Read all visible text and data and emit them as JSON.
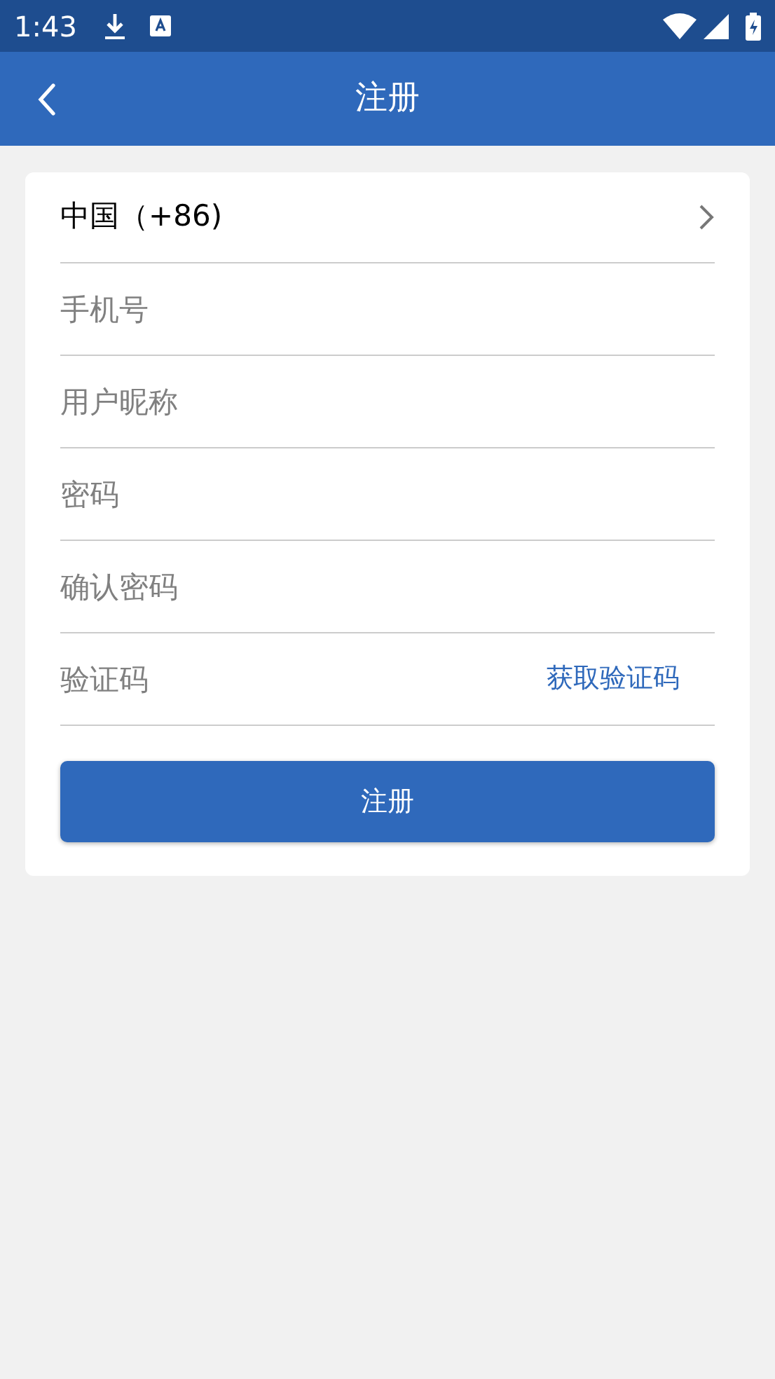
{
  "status_bar": {
    "time": "1:43"
  },
  "app_bar": {
    "title": "注册"
  },
  "country": {
    "value": "中国（+86)"
  },
  "fields": [
    {
      "kind": "text",
      "placeholder": "手机号"
    },
    {
      "kind": "text",
      "placeholder": "用户昵称"
    },
    {
      "kind": "password",
      "placeholder": "密码"
    },
    {
      "kind": "password",
      "placeholder": "确认密码"
    },
    {
      "kind": "code",
      "placeholder": "验证码",
      "action": "获取验证码"
    }
  ],
  "submit": {
    "label": "注册"
  }
}
